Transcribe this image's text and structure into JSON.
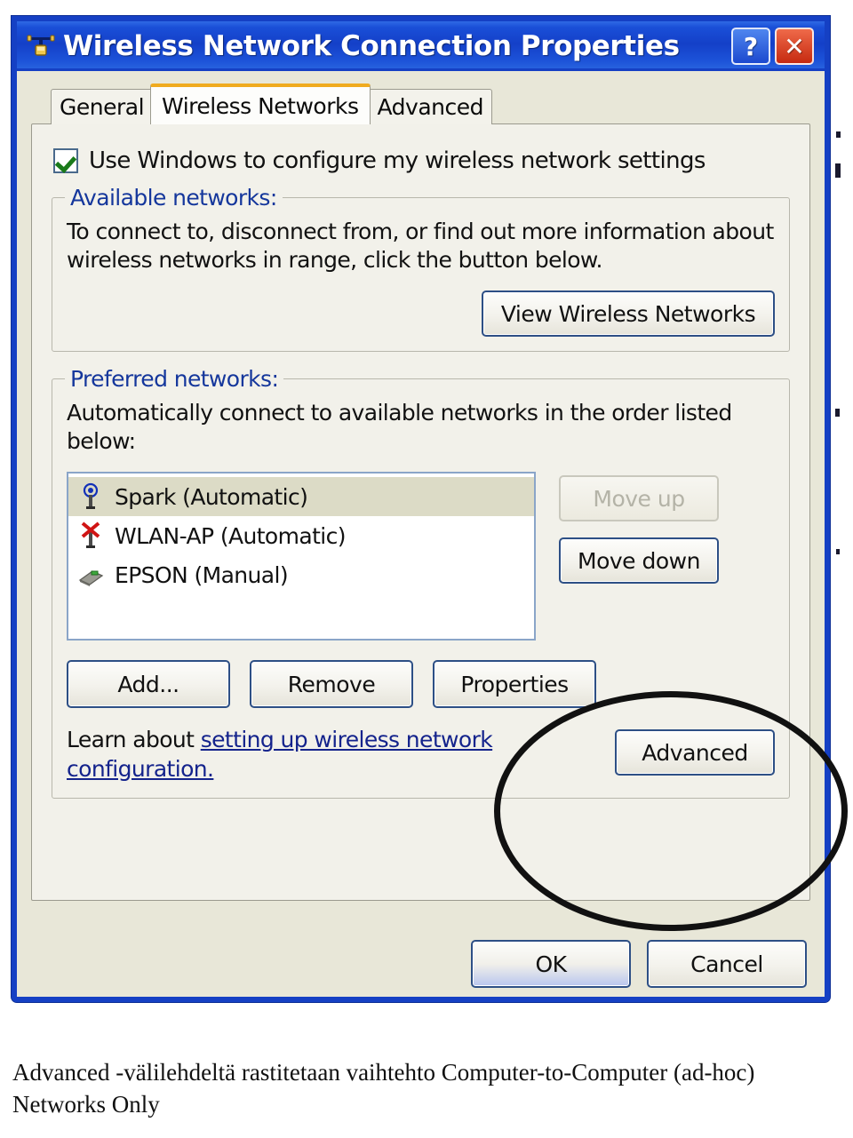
{
  "window": {
    "title": "Wireless Network Connection Properties",
    "icon": "network-connection-icon",
    "help_label": "?",
    "close_label": "✕",
    "accent_blue": "#1540c4",
    "body_bg": "#e8e7d8"
  },
  "tabs": [
    {
      "label": "General",
      "active": false
    },
    {
      "label": "Wireless Networks",
      "active": true
    },
    {
      "label": "Advanced",
      "active": false
    }
  ],
  "active_tab_accent": "#f0ab1e",
  "checkbox": {
    "label": "Use Windows to configure my wireless network settings",
    "checked": true,
    "check_color": "#1a7a1a"
  },
  "available_networks": {
    "legend": "Available networks:",
    "description": "To connect to, disconnect from, or find out more information about wireless networks in range, click the button below.",
    "view_button": "View Wireless Networks"
  },
  "preferred_networks": {
    "legend": "Preferred networks:",
    "description": "Automatically connect to available networks in the order listed below:",
    "items": [
      {
        "name": "Spark (Automatic)",
        "icon": "wireless-signal-icon",
        "selected": true
      },
      {
        "name": "WLAN-AP (Automatic)",
        "icon": "wireless-disconnected-icon",
        "selected": false
      },
      {
        "name": "EPSON (Manual)",
        "icon": "network-card-icon",
        "selected": false
      }
    ],
    "move_up": "Move up",
    "move_up_disabled": true,
    "move_down": "Move down",
    "move_down_disabled": false,
    "add": "Add...",
    "remove": "Remove",
    "properties": "Properties",
    "learn_prefix": "Learn about ",
    "learn_link": "setting up wireless network configuration.",
    "advanced": "Advanced"
  },
  "footer": {
    "ok": "OK",
    "cancel": "Cancel"
  },
  "annotation": {
    "shape": "ellipse",
    "target": "advanced-button",
    "color": "#111111"
  },
  "caption": {
    "text": "Advanced -välilehdeltä rastitetaan vaihtehto Computer-to-Computer (ad-hoc) Networks Only"
  }
}
